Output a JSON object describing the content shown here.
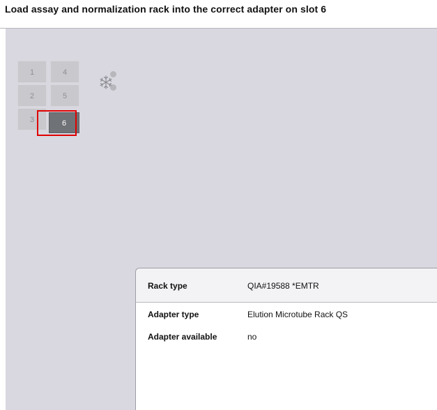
{
  "header": {
    "title": "Load assay and normalization rack into the correct adapter on slot 6"
  },
  "deck": {
    "slots": [
      {
        "label": "1",
        "active": false
      },
      {
        "label": "2",
        "active": false
      },
      {
        "label": "3",
        "active": false
      },
      {
        "label": "4",
        "active": false
      },
      {
        "label": "5",
        "active": false
      },
      {
        "label": "6",
        "active": true
      }
    ],
    "selected_slot": "6",
    "cooling_icon": "snowflake-icon",
    "indicator_icons": [
      "status-dot",
      "status-dot"
    ]
  },
  "details": {
    "rack_type_label": "Rack type",
    "rack_type_value": "QIA#19588 *EMTR",
    "adapter_type_label": "Adapter type",
    "adapter_type_value": "Elution Microtube Rack QS",
    "adapter_available_label": "Adapter available",
    "adapter_available_value": "no"
  },
  "colors": {
    "background": "#d9d8e0",
    "slot": "#c8c8cd",
    "slot_active": "#6f7276",
    "highlight": "#e00000",
    "panel": "#ffffff"
  }
}
